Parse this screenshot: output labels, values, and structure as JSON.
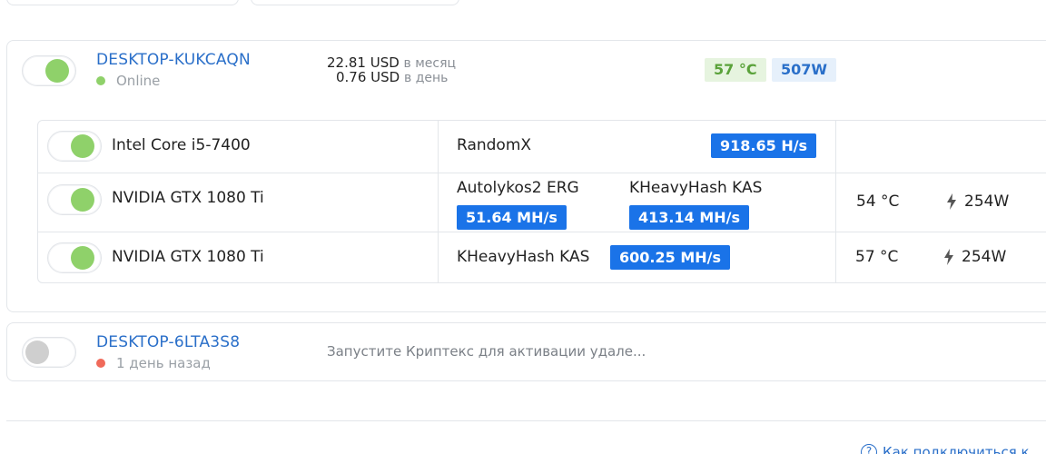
{
  "rigs": [
    {
      "name": "DESKTOP-KUKCAQN",
      "status": "Online",
      "enabled": true,
      "income_month_value": "22.81 USD",
      "income_month_unit": "в месяц",
      "income_day_value": "0.76 USD",
      "income_day_unit": "в день",
      "temperature": "57 °C",
      "power": "507W",
      "devices": [
        {
          "name": "Intel Core i5-7400",
          "enabled": true,
          "algorithms": [
            {
              "name": "RandomX",
              "hashrate": "918.65 H/s"
            }
          ],
          "temperature": "",
          "power": ""
        },
        {
          "name": "NVIDIA GTX 1080 Ti",
          "enabled": true,
          "algorithms": [
            {
              "name": "Autolykos2 ERG",
              "hashrate": "51.64 MH/s"
            },
            {
              "name": "KHeavyHash KAS",
              "hashrate": "413.14 MH/s"
            }
          ],
          "temperature": "54 °C",
          "power": "254W"
        },
        {
          "name": "NVIDIA GTX 1080 Ti",
          "enabled": true,
          "algorithms": [
            {
              "name": "KHeavyHash KAS",
              "hashrate": "600.25 MH/s"
            }
          ],
          "temperature": "57 °C",
          "power": "254W"
        }
      ]
    },
    {
      "name": "DESKTOP-6LTA3S8",
      "status": "1 день назад",
      "enabled": false,
      "hint": "Запустите Криптекс для активации удале..."
    }
  ],
  "footer": {
    "help_link": "Как подключиться к"
  },
  "colors": {
    "link_blue": "#2a6fc9",
    "hash_badge": "#1a73e8",
    "online_green": "#8fd16a",
    "offline_red": "#f06a5a"
  }
}
